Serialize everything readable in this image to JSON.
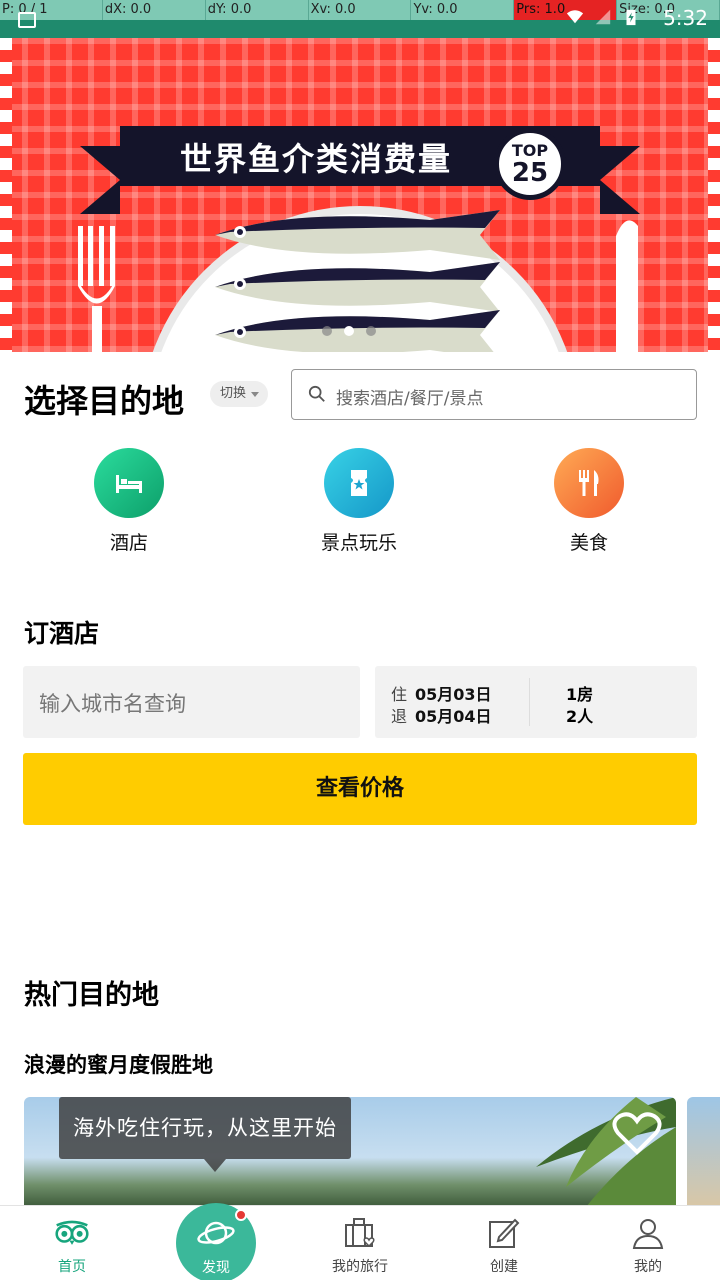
{
  "debug": {
    "cells": [
      "P: 0 / 1",
      "dX: 0.0",
      "dY: 0.0",
      "Xv: 0.0",
      "Yv: 0.0",
      "Prs: 1.0",
      "Size: 0.0"
    ]
  },
  "status_bar": {
    "time": "5:32"
  },
  "banner": {
    "title": "世界鱼介类消费量",
    "badge_top": "TOP",
    "badge_num": "25",
    "dots_count": 3,
    "active_dot": 1
  },
  "destination": {
    "title": "选择目的地",
    "switch_label": "切换",
    "search_placeholder": "搜索酒店/餐厅/景点"
  },
  "categories": [
    {
      "label": "酒店",
      "icon": "bed-icon"
    },
    {
      "label": "景点玩乐",
      "icon": "ticket-icon"
    },
    {
      "label": "美食",
      "icon": "fork-knife-icon"
    }
  ],
  "hotel": {
    "title": "订酒店",
    "city_placeholder": "输入城市名查询",
    "checkin_label": "住",
    "checkin_date": "05月03日",
    "checkout_label": "退",
    "checkout_date": "05月04日",
    "rooms": "1房",
    "guests": "2人",
    "button": "查看价格"
  },
  "popular": {
    "title": "热门目的地",
    "subtitle": "浪漫的蜜月度假胜地",
    "tooltip": "海外吃住行玩，从这里开始"
  },
  "nav": {
    "items": [
      {
        "label": "首页",
        "icon": "owl-icon",
        "active": true
      },
      {
        "label": "发现",
        "icon": "planet-icon",
        "active": false
      },
      {
        "label": "我的旅行",
        "icon": "suitcase-icon",
        "active": false
      },
      {
        "label": "创建",
        "icon": "edit-icon",
        "active": false
      },
      {
        "label": "我的",
        "icon": "user-icon",
        "active": false
      }
    ]
  },
  "colors": {
    "accent": "#17a57d",
    "button": "#ffcc00",
    "banner": "#ff3b30"
  }
}
